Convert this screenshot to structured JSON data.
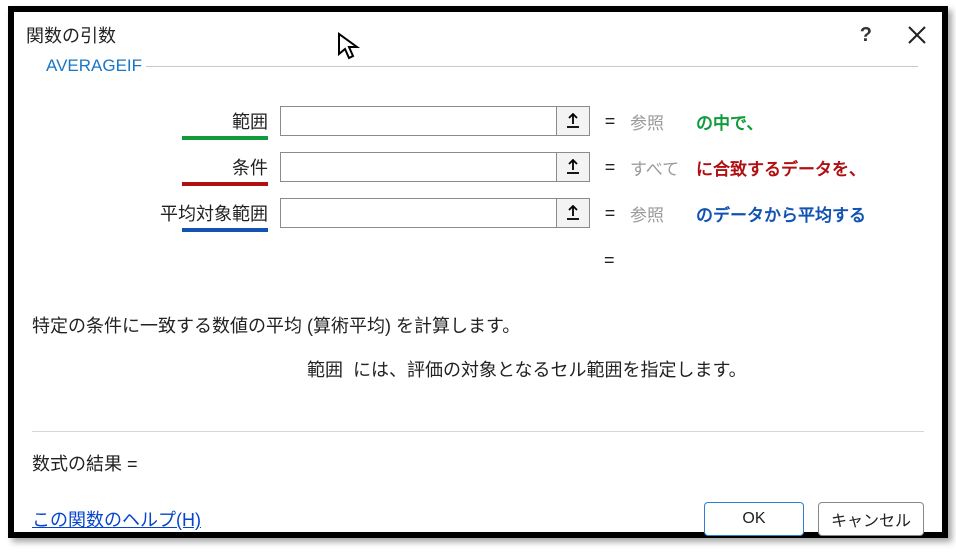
{
  "dialog": {
    "title": "関数の引数",
    "function_name": "AVERAGEIF",
    "args": [
      {
        "label": "範囲",
        "value": "",
        "hint": "参照",
        "annotation": "の中で、",
        "underline_color": "green",
        "annot_color": "green"
      },
      {
        "label": "条件",
        "value": "",
        "hint": "すべて",
        "annotation": "に合致するデータを、",
        "underline_color": "red",
        "annot_color": "red"
      },
      {
        "label": "平均対象範囲",
        "value": "",
        "hint": "参照",
        "annotation": "のデータから平均する",
        "underline_color": "blue",
        "annot_color": "blue"
      }
    ],
    "intermediate_equals": "=",
    "description_main": "特定の条件に一致する数値の平均 (算術平均) を計算します。",
    "description_sub_label": "範囲",
    "description_sub_text": "には、評価の対象となるセル範囲を指定します。",
    "formula_result_label": "数式の結果 =",
    "formula_result_value": "",
    "help_link": "この関数のヘルプ(H)",
    "ok_label": "OK",
    "cancel_label": "キャンセル"
  }
}
